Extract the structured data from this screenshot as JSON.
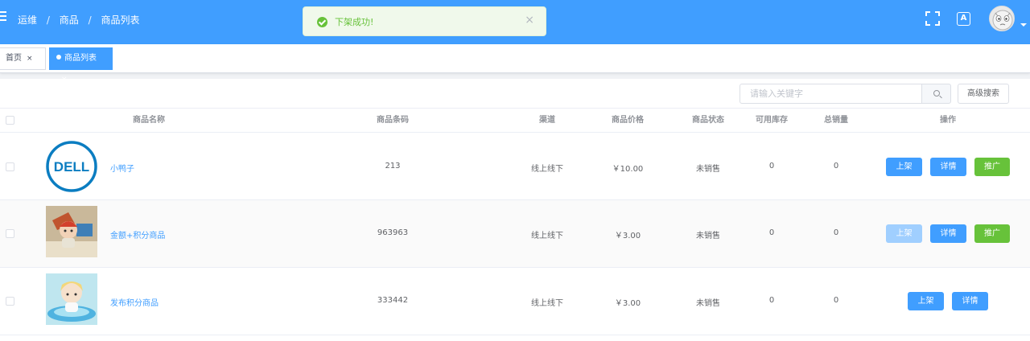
{
  "header": {
    "breadcrumb": [
      "运维",
      "商品",
      "商品列表"
    ],
    "separator": "/",
    "toast": {
      "message": "下架成功!",
      "close": "×"
    },
    "lang_icon": "A",
    "accent": "#409eff"
  },
  "tags": [
    {
      "label": "首页",
      "close": "×"
    },
    {
      "label": "商品列表",
      "close": "×"
    }
  ],
  "toolbar": {
    "search_placeholder": "请输入关键字",
    "advanced_search_label": "高级搜索"
  },
  "table": {
    "columns": [
      "商品名称",
      "商品条码",
      "渠道",
      "商品价格",
      "商品状态",
      "可用库存",
      "总销量",
      "操作"
    ],
    "rows": [
      {
        "name": "小鸭子",
        "barcode": "213",
        "channel": "线上线下",
        "price": "￥10.00",
        "status": "未销售",
        "stock": "0",
        "sales": "0",
        "image": "dell-logo",
        "actions": [
          "上架",
          "详情",
          "推广"
        ]
      },
      {
        "name": "金额+积分商品",
        "barcode": "963963",
        "channel": "线上线下",
        "price": "￥3.00",
        "status": "未销售",
        "stock": "0",
        "sales": "0",
        "image": "toy-figure-photo",
        "actions": [
          "上架",
          "详情",
          "推广"
        ]
      },
      {
        "name": "发布积分商品",
        "barcode": "333442",
        "channel": "线上线下",
        "price": "￥3.00",
        "status": "未销售",
        "stock": "0",
        "sales": "0",
        "image": "doll-pool-photo",
        "actions": [
          "上架",
          "详情"
        ]
      }
    ]
  },
  "icons": {
    "menu": "hamburger-icon",
    "fullscreen": "fullscreen-icon",
    "language": "translate-icon",
    "search": "search-icon",
    "success": "success-check-icon",
    "logo_text": "DELL"
  }
}
